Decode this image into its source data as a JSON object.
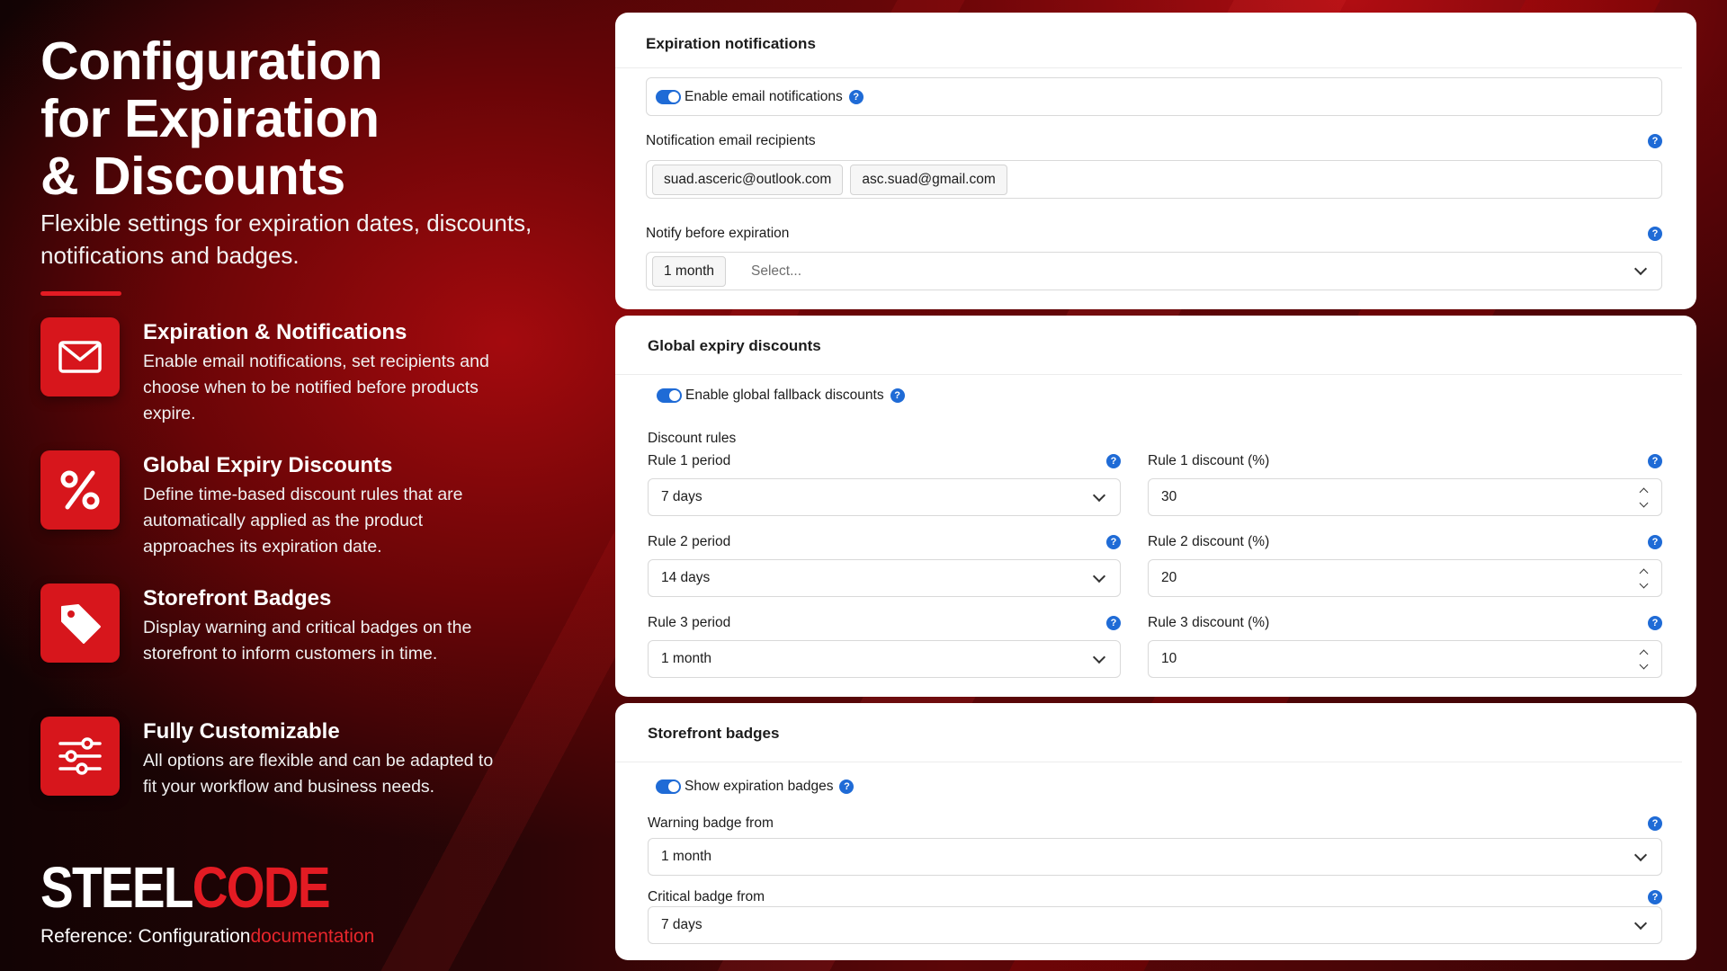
{
  "hero": {
    "title": "Configuration\nfor Expiration\n& Discounts",
    "subtitle": "Flexible settings for expiration dates, discounts, notifications and badges."
  },
  "features": [
    {
      "icon": "envelope-icon",
      "title": "Expiration & Notifications",
      "desc": "Enable email notifications, set recipients and choose when to be notified before products expire."
    },
    {
      "icon": "percent-icon",
      "title": "Global Expiry Discounts",
      "desc": "Define time-based discount rules that are automatically applied as the product approaches its expiration date."
    },
    {
      "icon": "tag-icon",
      "title": "Storefront Badges",
      "desc": "Display warning and critical badges on the storefront to inform customers in time."
    },
    {
      "icon": "sliders-icon",
      "title": "Fully Customizable",
      "desc": "All options are flexible and can be adapted to fit your workflow and business needs."
    }
  ],
  "brand": {
    "part1": "STEEL",
    "part2": "CODE"
  },
  "reference": {
    "prefix": "Reference: Configuration",
    "link": "documentation"
  },
  "expiration": {
    "title": "Expiration notifications",
    "enable_label": "Enable email notifications",
    "recipients_label": "Notification email recipients",
    "recipients": [
      "suad.asceric@outlook.com",
      "asc.suad@gmail.com"
    ],
    "notify_label": "Notify before expiration",
    "notify_selected": "1 month",
    "notify_placeholder": "Select..."
  },
  "discounts": {
    "title": "Global expiry discounts",
    "enable_label": "Enable global fallback discounts",
    "rules_label": "Discount rules",
    "rules": [
      {
        "period_label": "Rule 1 period",
        "period": "7 days",
        "discount_label": "Rule 1 discount (%)",
        "discount": "30"
      },
      {
        "period_label": "Rule 2 period",
        "period": "14 days",
        "discount_label": "Rule 2 discount (%)",
        "discount": "20"
      },
      {
        "period_label": "Rule 3 period",
        "period": "1 month",
        "discount_label": "Rule 3 discount (%)",
        "discount": "10"
      }
    ]
  },
  "badges": {
    "title": "Storefront badges",
    "show_label": "Show expiration badges",
    "warning_label": "Warning badge from",
    "warning_value": "1 month",
    "critical_label": "Critical badge from",
    "critical_value": "7 days"
  },
  "colors": {
    "accent": "#e31b23",
    "toggle": "#1f6bd6",
    "help": "#1f6bd6"
  }
}
